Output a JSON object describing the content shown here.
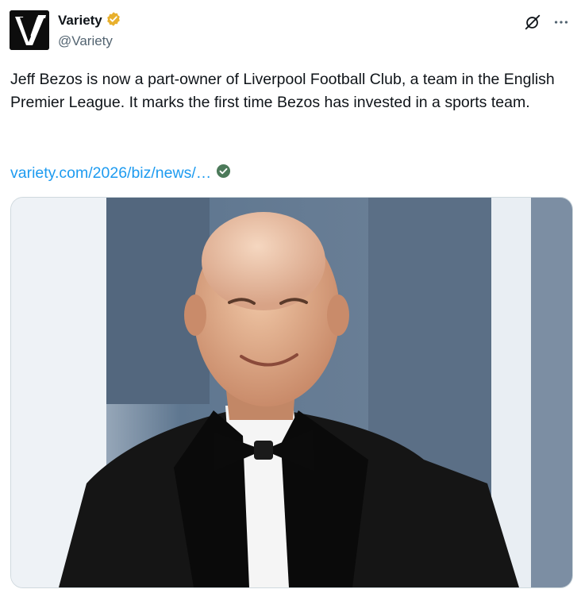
{
  "account": {
    "display_name": "Variety",
    "handle": "@Variety",
    "avatar_icon": "variety-v-logo-icon",
    "verified_icon": "gold-verified-badge-icon",
    "verified_color": "#E8B02D"
  },
  "actions": {
    "grok_icon": "grok-icon",
    "more_icon": "more-horizontal-icon"
  },
  "tweet": {
    "text": "Jeff Bezos is now a part-owner of Liverpool Football Club, a team in the English Premier League. It marks the first time Bezos has invested in a sports team.",
    "link_text": "variety.com/2026/biz/news/…",
    "link_badge_icon": "verified-link-check-icon",
    "link_color": "#1d9bf0"
  },
  "media": {
    "image_icon": "photo-man-in-tuxedo-bow-tie"
  }
}
